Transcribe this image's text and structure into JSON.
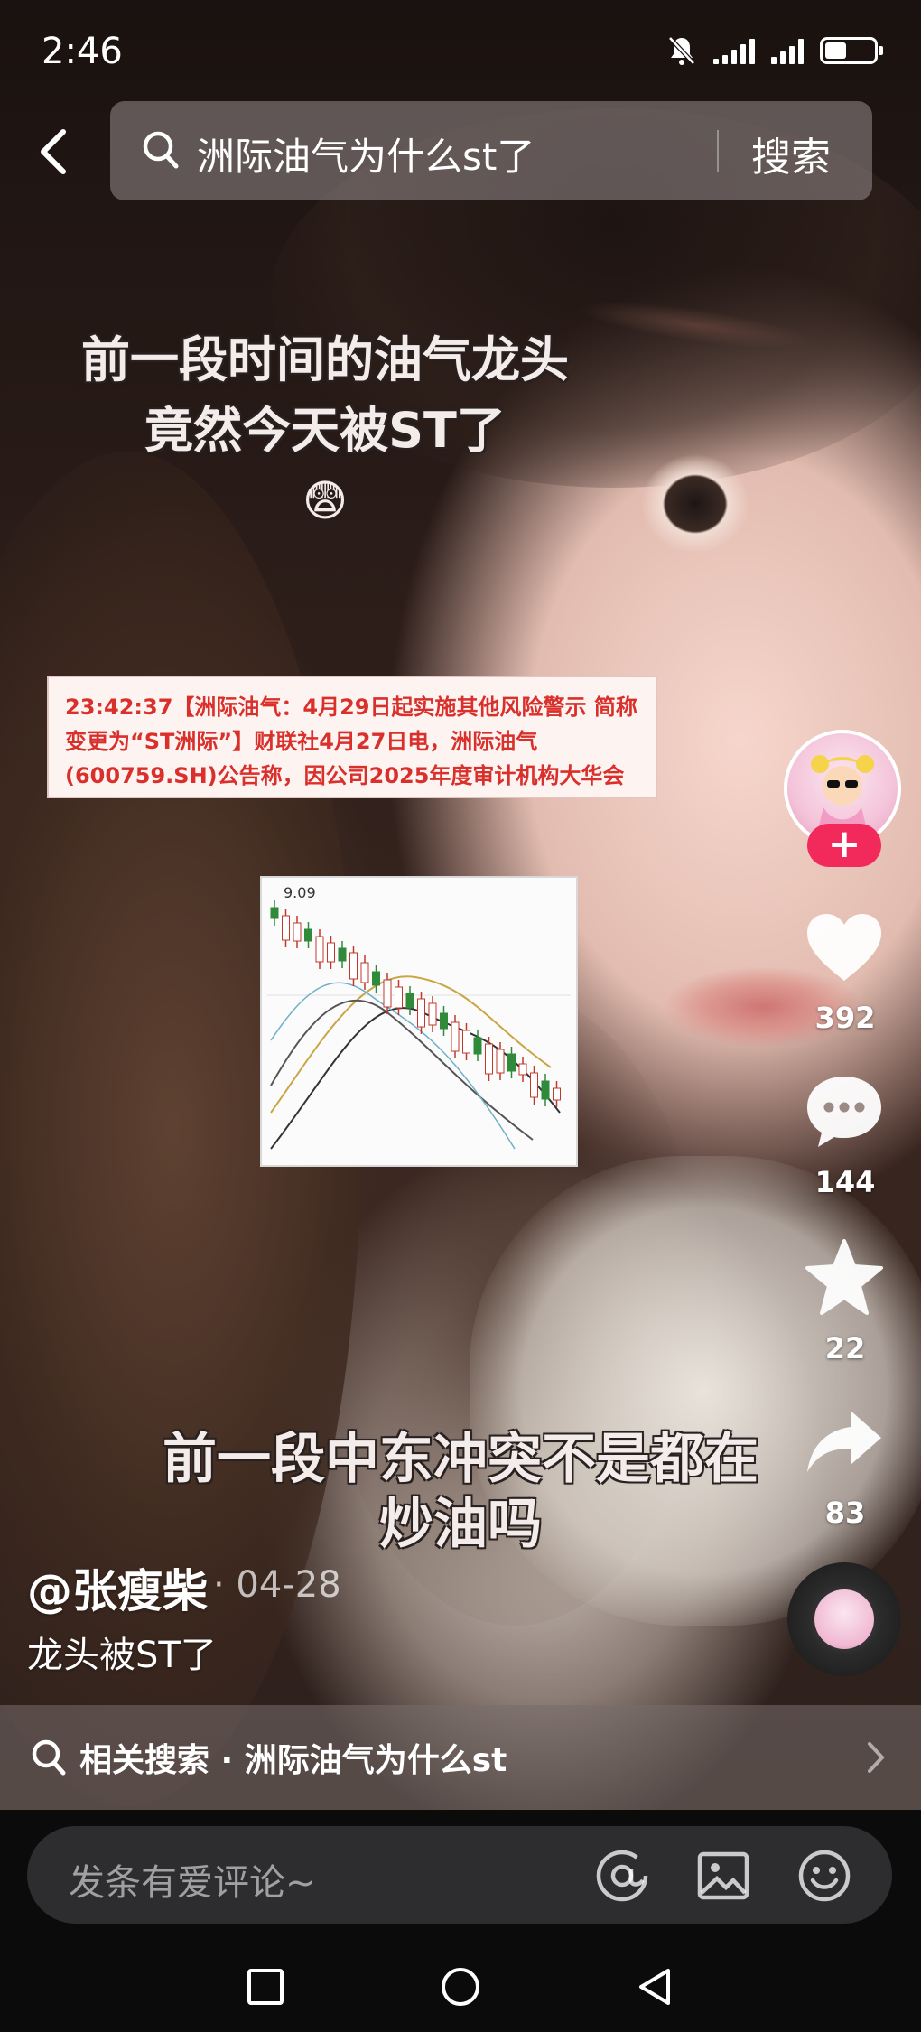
{
  "status_bar": {
    "time": "2:46",
    "battery_level": 0.45
  },
  "search": {
    "query": "洲际油气为什么st了",
    "button_label": "搜索"
  },
  "overlay": {
    "caption_top_line1": "前一段时间的油气龙头",
    "caption_top_line2": "竟然今天被ST了",
    "caption_emoji": "😨",
    "caption_bottom_line1": "前一段中东冲突不是都在",
    "caption_bottom_line2": "炒油吗"
  },
  "news_clip": {
    "line1": "23:42:37【洲际油气：4月29日起实施其他风险警示 简称",
    "line2": "变更为“ST洲际”】财联社4月27日电，洲际油气",
    "line3": "(600759.SH)公告称，因公司2025年度审计机构大华会"
  },
  "chart_clip": {
    "label": "9.09"
  },
  "rail": {
    "follow_label": "+",
    "likes": "392",
    "comments": "144",
    "favorites": "22",
    "shares": "83"
  },
  "post": {
    "author": "@张瘦柴",
    "date": "· 04-28",
    "description": "龙头被ST了"
  },
  "related": {
    "text": "相关搜索 · 洲际油气为什么st"
  },
  "comment_bar": {
    "placeholder": "发条有爱评论~"
  },
  "colors": {
    "accent": "#f2295b",
    "news_red": "#d9302c"
  },
  "icons": [
    "back-icon",
    "search-icon",
    "mute-bell-icon",
    "signal-icon",
    "battery-icon",
    "heart-icon",
    "comment-icon",
    "star-icon",
    "share-icon",
    "at-icon",
    "image-icon",
    "emoji-icon",
    "nav-square-icon",
    "nav-circle-icon",
    "nav-back-icon",
    "chevron-right-icon"
  ]
}
